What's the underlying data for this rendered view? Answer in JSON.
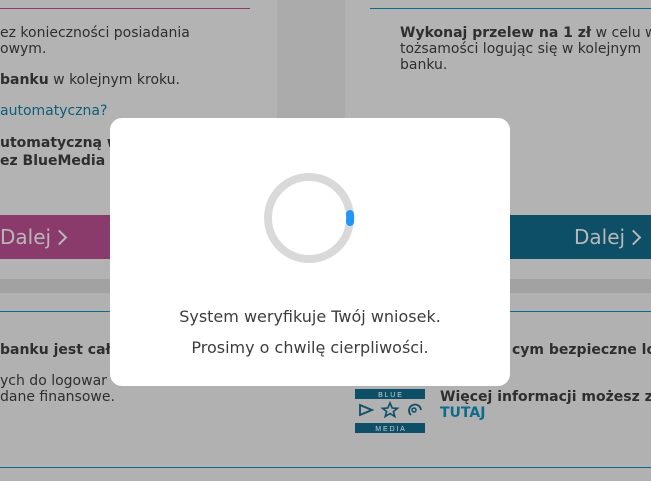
{
  "left_card": {
    "line1": "ez konieczności posiadania",
    "line2": "owym.",
    "line3_bold": "banku",
    "line3_rest": " w kolejnym kroku.",
    "question_link": "automatyczna?",
    "line5_bold": "utomatyczną w",
    "line6_bold": "ez BlueMedia S",
    "button_label": "Dalej"
  },
  "right_card": {
    "line1_bold": "Wykonaj przelew na 1 zł",
    "line1_rest": " w celu we",
    "line2": "tożsamości logując się w kolejnym",
    "line3": "banku.",
    "button_label": "Dalej"
  },
  "bottom": {
    "left_bold": "banku jest całk",
    "left_line2": "ych do logowar",
    "left_line3": " dane finansowe.",
    "right_bold": "cym bezpieczne log",
    "more_info": "Więcej informacji możesz zna",
    "here_link": "TUTAJ",
    "logo_text_top": "B L U E",
    "logo_text_bottom": "M E D I A"
  },
  "modal": {
    "message_line1": "System weryfikuje Twój wniosek.",
    "message_line2": "Prosimy o chwilę cierpliwości."
  },
  "colors": {
    "accent_magenta": "#8b3a6c",
    "accent_teal": "#0c4f67",
    "spinner_blue": "#2196f3",
    "spinner_track": "#d9d9d9"
  },
  "icons": {
    "button_chevron": "chevron-right-icon",
    "loading": "spinner-icon",
    "logo": "bluemedia-logo-icon"
  }
}
